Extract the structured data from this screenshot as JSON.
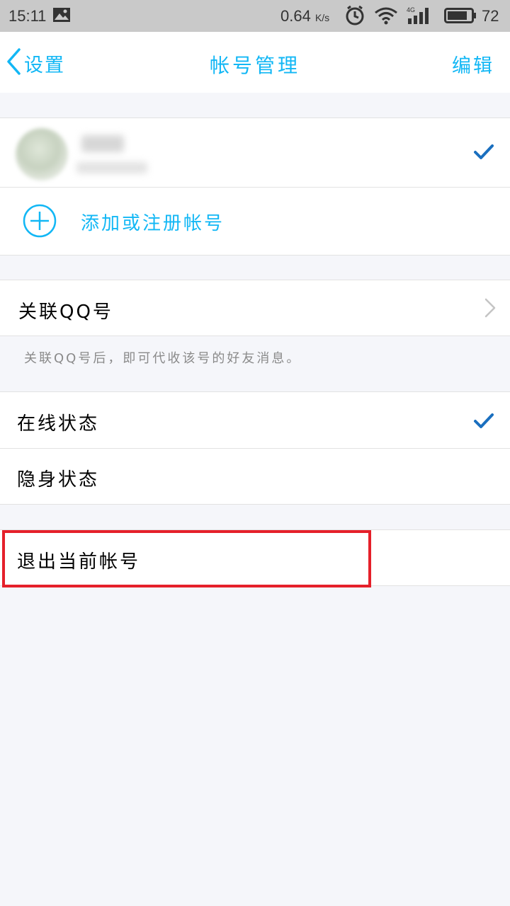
{
  "status_bar": {
    "time": "15:11",
    "speed": "0.64",
    "speed_unit": "K/s",
    "network": "4G",
    "battery": "72"
  },
  "navbar": {
    "back_label": "设置",
    "title": "帐号管理",
    "edit_label": "编辑"
  },
  "accounts": {
    "add_label": "添加或注册帐号"
  },
  "link_qq": {
    "label": "关联QQ号",
    "hint": "关联QQ号后，即可代收该号的好友消息。"
  },
  "status_options": [
    {
      "label": "在线状态",
      "selected": true
    },
    {
      "label": "隐身状态",
      "selected": false
    }
  ],
  "logout": {
    "label": "退出当前帐号"
  },
  "colors": {
    "accent": "#12b7f5",
    "check": "#1a6fbf",
    "highlight": "#e5202a",
    "background": "#f5f6fa"
  }
}
